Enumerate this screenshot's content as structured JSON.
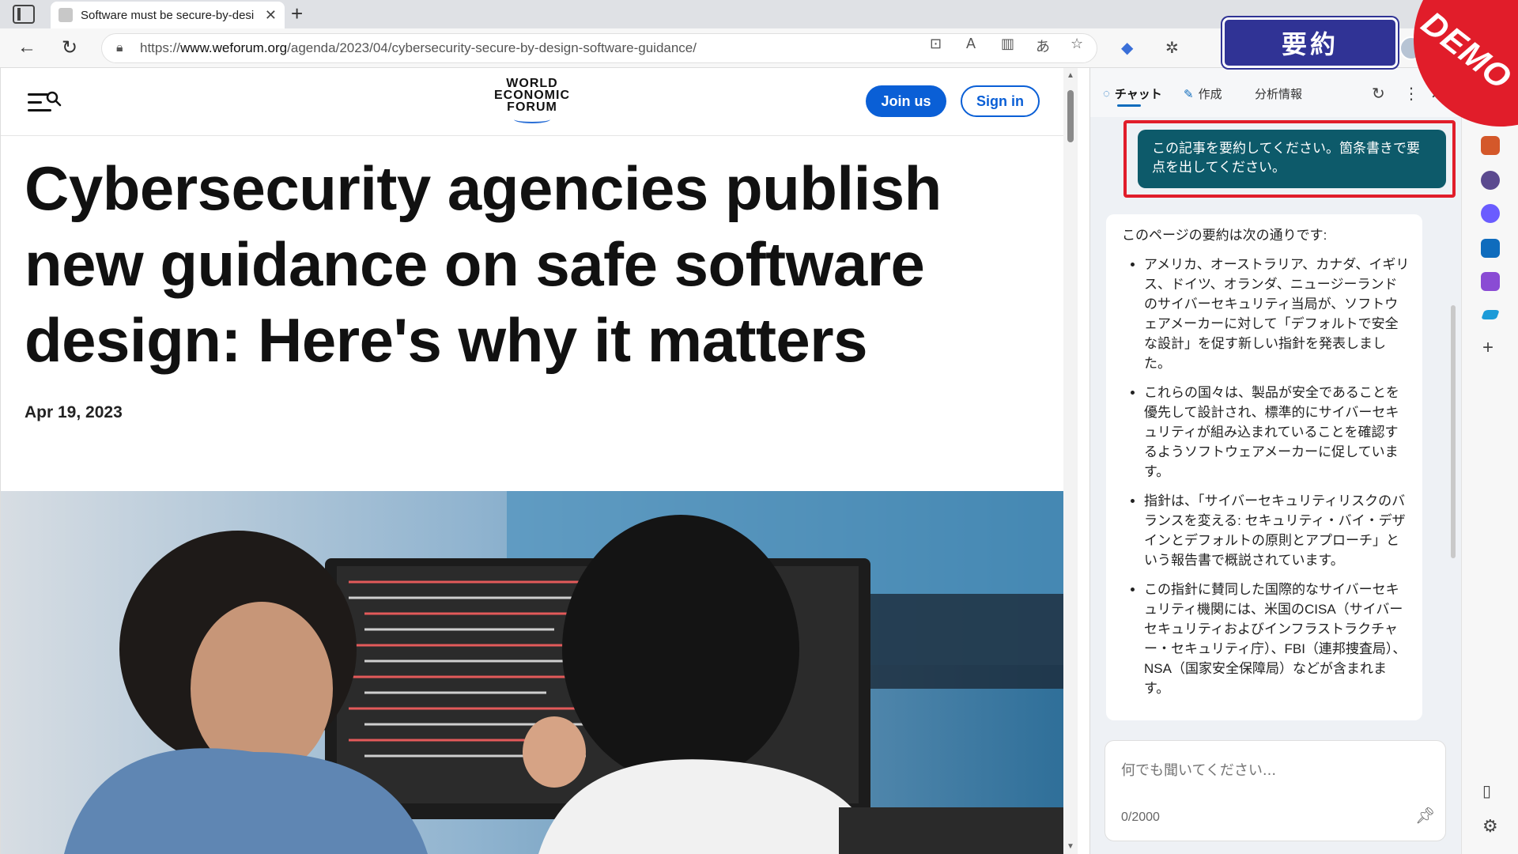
{
  "browser": {
    "tab_title": "Software must be secure-by-desi",
    "url_prefix": "https://",
    "url_domain": "www.weforum.org",
    "url_path": "/agenda/2023/04/cybersecurity-secure-by-design-software-guidance/"
  },
  "page": {
    "logo_lines": [
      "WORLD",
      "ECONOMIC",
      "FORUM"
    ],
    "join_label": "Join us",
    "signin_label": "Sign in",
    "headline": "Cybersecurity agencies publish new guidance on safe software design: Here's why it matters",
    "date": "Apr 19, 2023"
  },
  "copilot": {
    "tabs": [
      "チャット",
      "作成",
      "分析情報"
    ],
    "user_message": "この記事を要約してください。箇条書きで要点を出してください。",
    "answer_intro": "このページの要約は次の通りです:",
    "bullets": [
      "アメリカ、オーストラリア、カナダ、イギリス、ドイツ、オランダ、ニュージーランドのサイバーセキュリティ当局が、ソフトウェアメーカーに対して「デフォルトで安全な設計」を促す新しい指針を発表しました。",
      "これらの国々は、製品が安全であることを優先して設計され、標準的にサイバーセキュリティが組み込まれていることを確認するようソフトウェアメーカーに促しています。",
      "指針は、「サイバーセキュリティリスクのバランスを変える: セキュリティ・バイ・デザインとデフォルトの原則とアプローチ」という報告書で概説されています。",
      "この指針に賛同した国際的なサイバーセキュリティ機関には、米国のCISA（サイバーセキュリティおよびインフラストラクチャー・セキュリティ庁）、FBI（連邦捜査局）、NSA（国家安全保障局）などが含まれます。"
    ],
    "input_placeholder": "何でも聞いてください...",
    "counter": "0/2000"
  },
  "overlay": {
    "badge": "要約",
    "demo": "DEMO"
  },
  "colors": {
    "accent": "#0a5fd6",
    "badge_bg": "#303395",
    "highlight": "#e11d2a",
    "user_bubble": "#0d5a6a"
  }
}
